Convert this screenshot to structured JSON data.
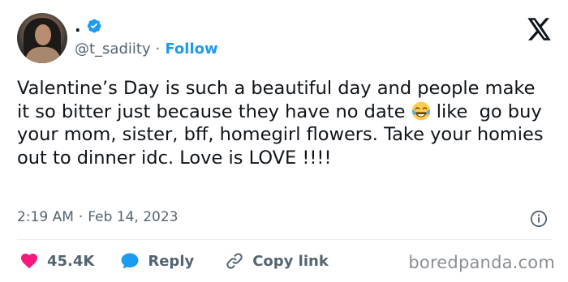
{
  "author": {
    "display_name": ".",
    "handle": "@t_sadiity",
    "separator": "·",
    "follow_label": "Follow",
    "verified": true
  },
  "tweet": {
    "text_part1": "Valentine’s Day is such a beautiful day and people make it so bitter just because they have no date ",
    "emoji": "face-with-tears-of-joy",
    "text_part2": " like  go buy your mom, sister, bff, homegirl flowers. Take your homies out to dinner idc. Love is LOVE !!!!",
    "time": "2:19 AM",
    "separator": "·",
    "date": "Feb 14, 2023"
  },
  "actions": {
    "likes_count": "45.4K",
    "reply_label": "Reply",
    "copy_link_label": "Copy link"
  },
  "watermark": "boredpanda.com",
  "colors": {
    "accent": "#1d9bf0",
    "like": "#f91880",
    "text": "#0f1419",
    "secondary": "#536471"
  }
}
